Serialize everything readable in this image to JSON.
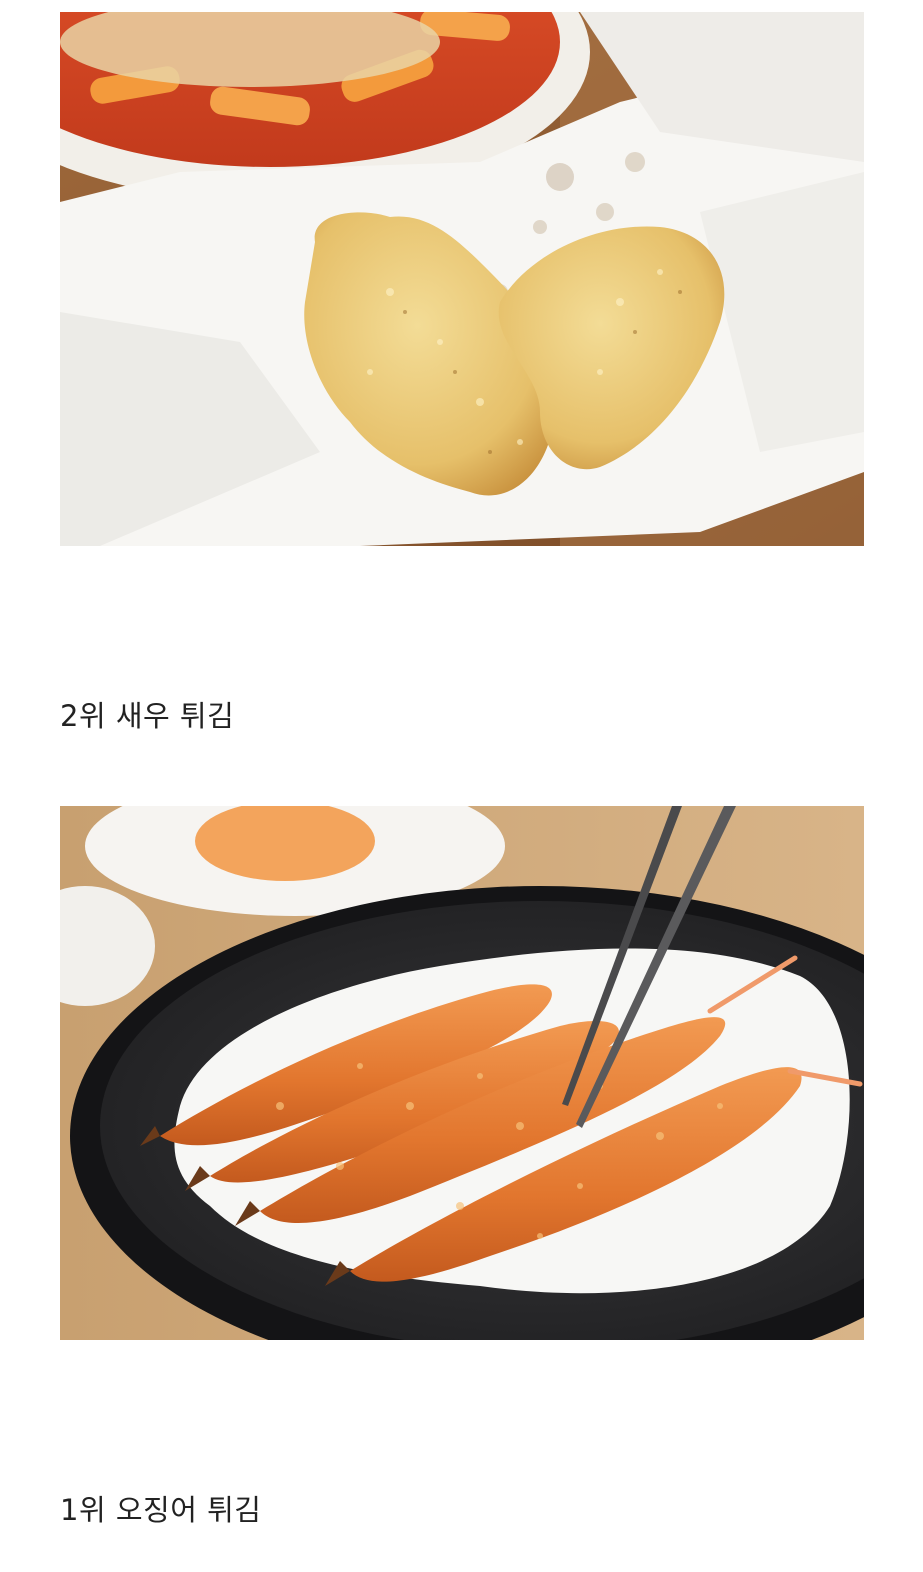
{
  "posts": [
    {
      "image_subject": "fried vegetable patties on parchment paper beside tteokbokki",
      "caption": ""
    },
    {
      "image_subject": "fried breaded shrimp on a black plate with chopsticks",
      "caption": "2위 새우 튀김"
    },
    {
      "caption": "1위 오징어 튀김"
    }
  ]
}
